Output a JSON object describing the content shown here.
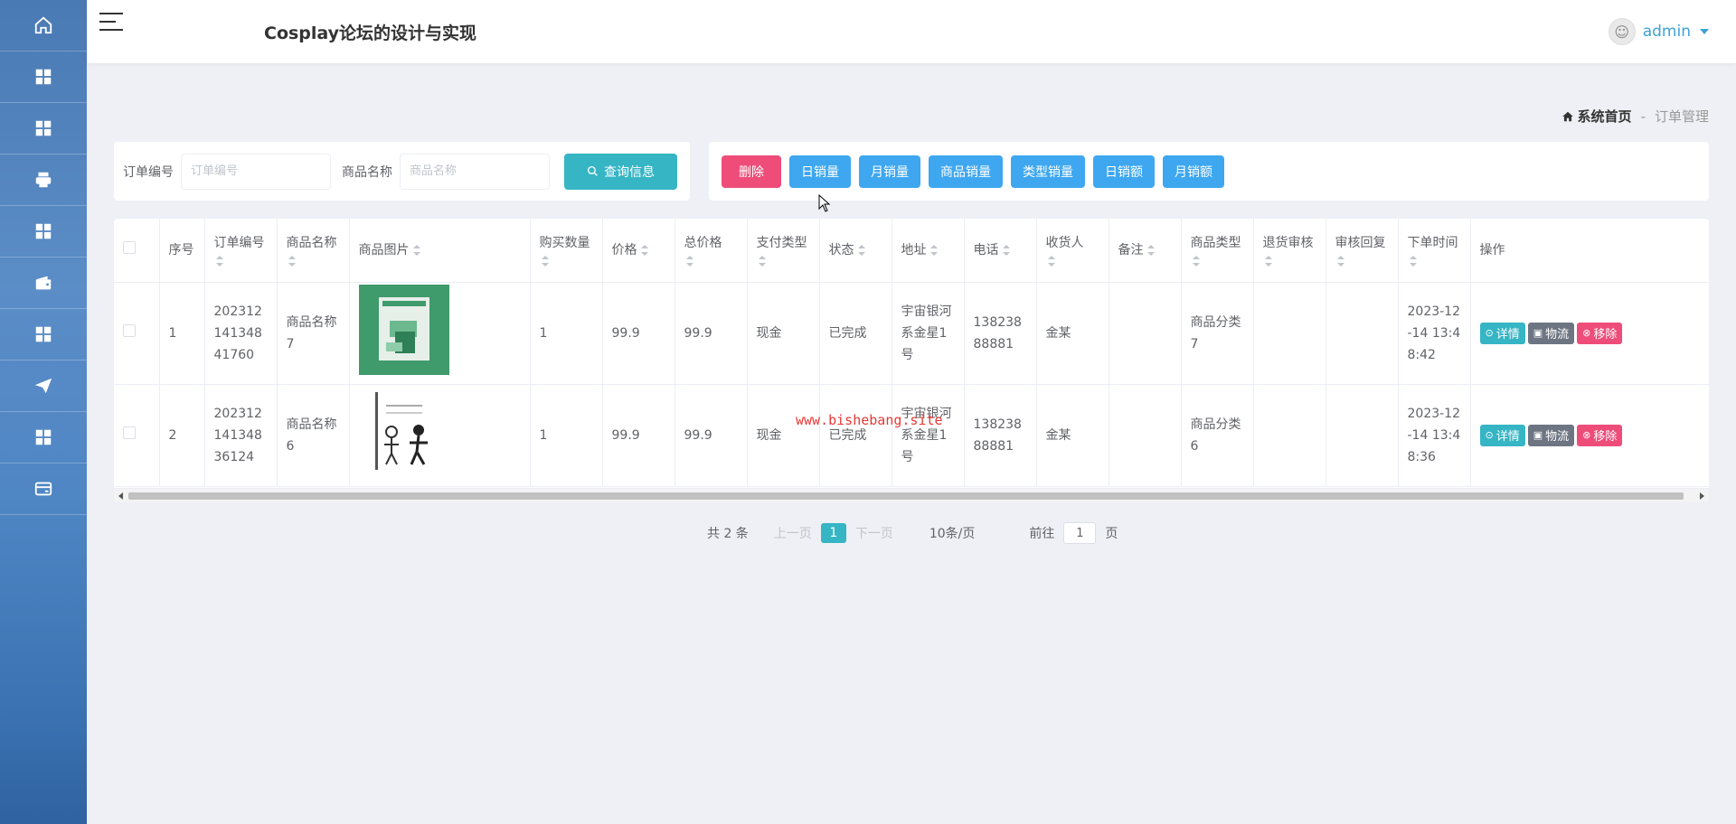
{
  "header": {
    "title": "Cosplay论坛的设计与实现",
    "user": "admin"
  },
  "sidebar": {
    "items": [
      {
        "icon": "home-icon"
      },
      {
        "icon": "grid-icon"
      },
      {
        "icon": "grid-icon"
      },
      {
        "icon": "print-icon"
      },
      {
        "icon": "grid-icon"
      },
      {
        "icon": "wallet-icon"
      },
      {
        "icon": "grid-icon"
      },
      {
        "icon": "send-icon"
      },
      {
        "icon": "grid-icon"
      },
      {
        "icon": "card-icon"
      }
    ]
  },
  "breadcrumb": {
    "home": "系统首页",
    "separator": "-",
    "current": "订单管理"
  },
  "search": {
    "order_no_label": "订单编号",
    "order_no_placeholder": "订单编号",
    "product_label": "商品名称",
    "product_placeholder": "商品名称",
    "query_button": "查询信息"
  },
  "actions": {
    "delete": "删除",
    "daily_sales": "日销量",
    "monthly_sales": "月销量",
    "product_sales": "商品销量",
    "type_sales": "类型销量",
    "daily_revenue": "日销额",
    "monthly_revenue": "月销额"
  },
  "table": {
    "headers": {
      "index": "序号",
      "order_no": "订单编号",
      "product_name": "商品名称",
      "product_image": "商品图片",
      "quantity": "购买数量",
      "price": "价格",
      "total": "总价格",
      "pay_type": "支付类型",
      "status": "状态",
      "address": "地址",
      "phone": "电话",
      "receiver": "收货人",
      "remark": "备注",
      "product_type": "商品类型",
      "return_review": "退货审核",
      "review_reply": "审核回复",
      "order_time": "下单时间",
      "ops": "操作"
    },
    "rows": [
      {
        "index": "1",
        "order_no": "20231214134841760",
        "product_name": "商品名称7",
        "quantity": "1",
        "price": "99.9",
        "total": "99.9",
        "pay_type": "现金",
        "status": "已完成",
        "address": "宇宙银河系金星1号",
        "phone": "13823888881",
        "receiver": "金某",
        "remark": "",
        "product_type": "商品分类7",
        "return_review": "",
        "review_reply": "",
        "order_time": "2023-12-14 13:48:42",
        "image": "book-cover-green"
      },
      {
        "index": "2",
        "order_no": "20231214134836124",
        "product_name": "商品名称6",
        "quantity": "1",
        "price": "99.9",
        "total": "99.9",
        "pay_type": "现金",
        "status": "已完成",
        "address": "宇宙银河系金星1号",
        "phone": "13823888881",
        "receiver": "金某",
        "remark": "",
        "product_type": "商品分类6",
        "return_review": "",
        "review_reply": "",
        "order_time": "2023-12-14 13:48:36",
        "image": "illustration-sketch"
      }
    ],
    "ops": {
      "detail": "详情",
      "logistics": "物流",
      "remove": "移除"
    }
  },
  "watermark": "www.bishebang.site",
  "pagination": {
    "total": "共 2 条",
    "prev": "上一页",
    "current_page": "1",
    "next": "下一页",
    "page_size": "10条/页",
    "goto": "前往",
    "goto_value": "1",
    "page_unit": "页"
  },
  "colors": {
    "primary": "#36b5c4",
    "danger": "#ee4d7a",
    "info": "#3ea7f0",
    "dark": "#6d7583",
    "sidebar": "#4f86c4"
  }
}
